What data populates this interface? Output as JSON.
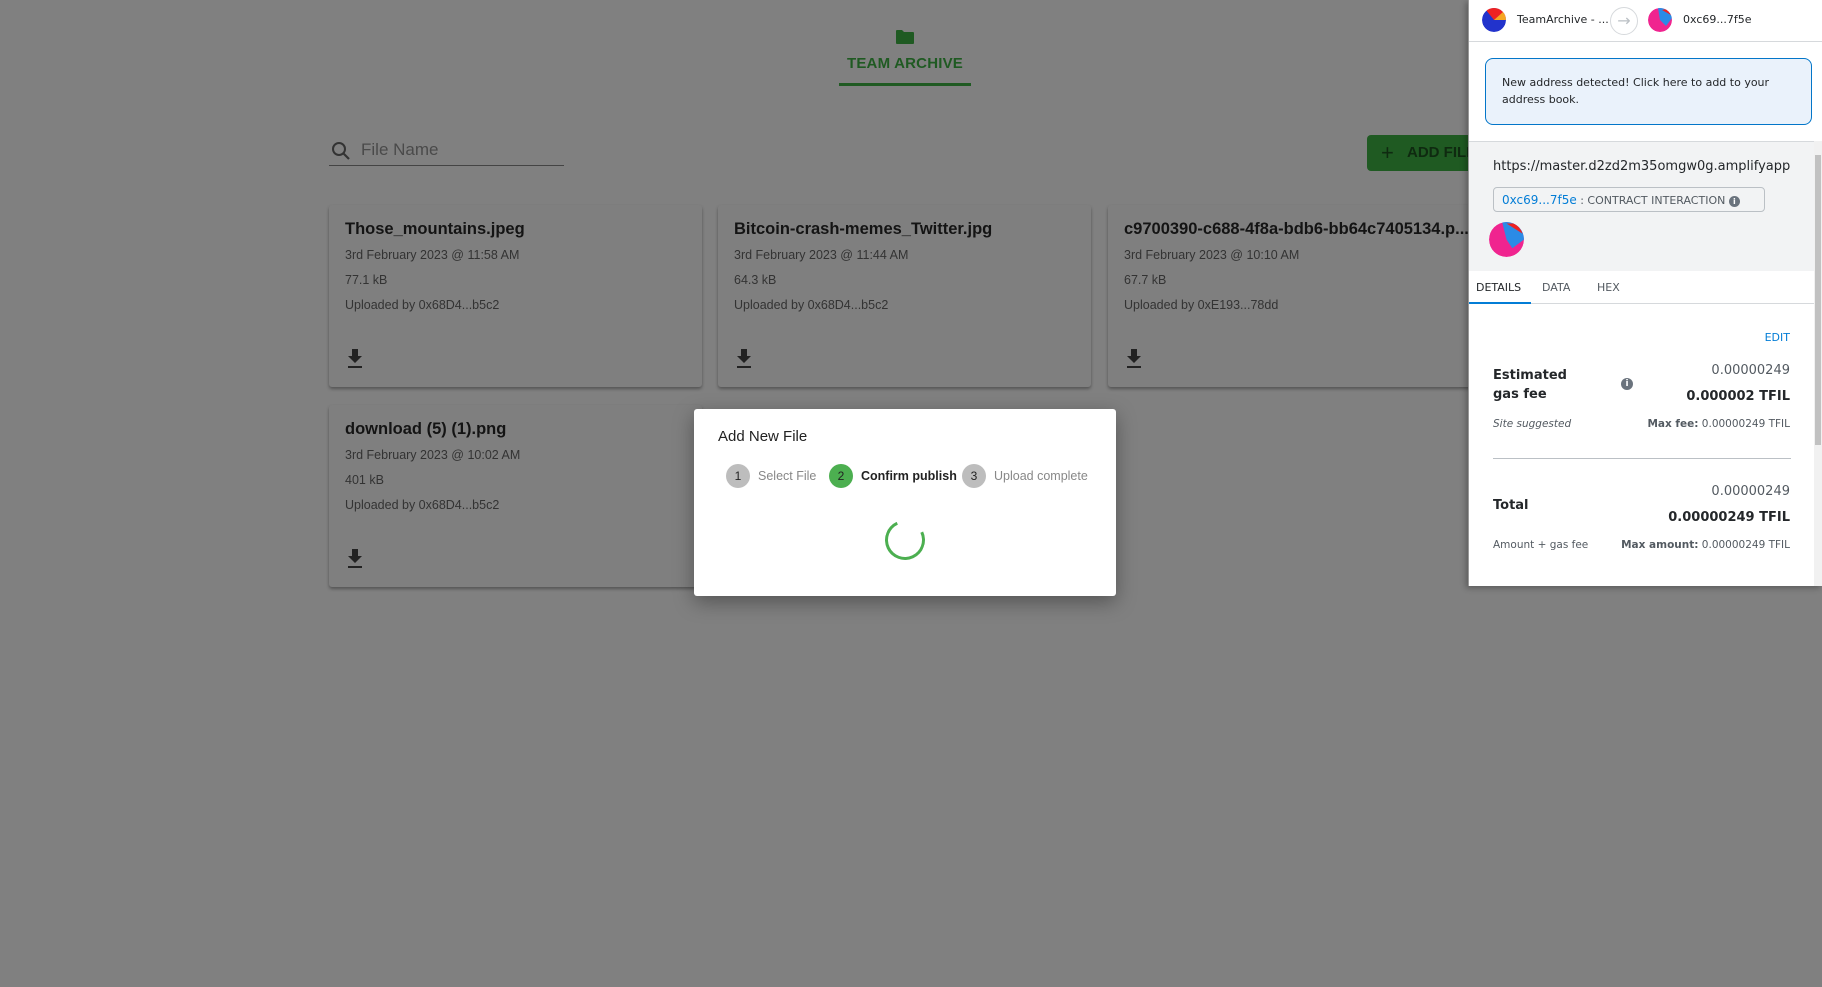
{
  "nav": {
    "title": "TEAM ARCHIVE",
    "icon": "folder-icon"
  },
  "search": {
    "placeholder": "File Name"
  },
  "add_button": {
    "label": "ADD FILE"
  },
  "files": [
    {
      "name": "Those_mountains.jpeg",
      "date": "3rd February 2023 @ 11:58 AM",
      "size": "77.1 kB",
      "uploader": "Uploaded by 0x68D4...b5c2"
    },
    {
      "name": "Bitcoin-crash-memes_Twitter.jpg",
      "date": "3rd February 2023 @ 11:44 AM",
      "size": "64.3 kB",
      "uploader": "Uploaded by 0x68D4...b5c2"
    },
    {
      "name": "c9700390-c688-4f8a-bdb6-bb64c7405134.p...",
      "date": "3rd February 2023 @ 10:10 AM",
      "size": "67.7 kB",
      "uploader": "Uploaded by 0xE193...78dd"
    },
    {
      "name": "download (5) (1).png",
      "date": "3rd February 2023 @ 10:02 AM",
      "size": "401 kB",
      "uploader": "Uploaded by 0x68D4...b5c2"
    }
  ],
  "modal": {
    "title": "Add New File",
    "steps": [
      {
        "n": "1",
        "label": "Select File"
      },
      {
        "n": "2",
        "label": "Confirm publish"
      },
      {
        "n": "3",
        "label": "Upload complete"
      }
    ],
    "active_step": 2
  },
  "wallet": {
    "from": "TeamArchive - ...",
    "to": "0xc69...7f5e",
    "notice": "New address detected! Click here to add to your address book.",
    "origin": "https://master.d2zd2m35omgw0g.amplifyapp",
    "contract_addr": "0xc69...7f5e",
    "contract_label": ": CONTRACT INTERACTION",
    "tabs": [
      "DETAILS",
      "DATA",
      "HEX"
    ],
    "edit": "EDIT",
    "gas_label": "Estimated gas fee",
    "gas_value": "0.00000249",
    "gas_value_bold": "0.000002 TFIL",
    "site_suggested": "Site suggested",
    "max_fee_label": "Max fee:",
    "max_fee": "0.00000249 TFIL",
    "total_label": "Total",
    "total_value": "0.00000249",
    "total_value_bold": "0.00000249 TFIL",
    "amount_gas": "Amount + gas fee",
    "max_amount_label": "Max amount:",
    "max_amount": "0.00000249 TFIL",
    "accent": "#037dd6"
  },
  "colors": {
    "brand_green": "#1f5a22",
    "step_active": "#4caf50"
  }
}
